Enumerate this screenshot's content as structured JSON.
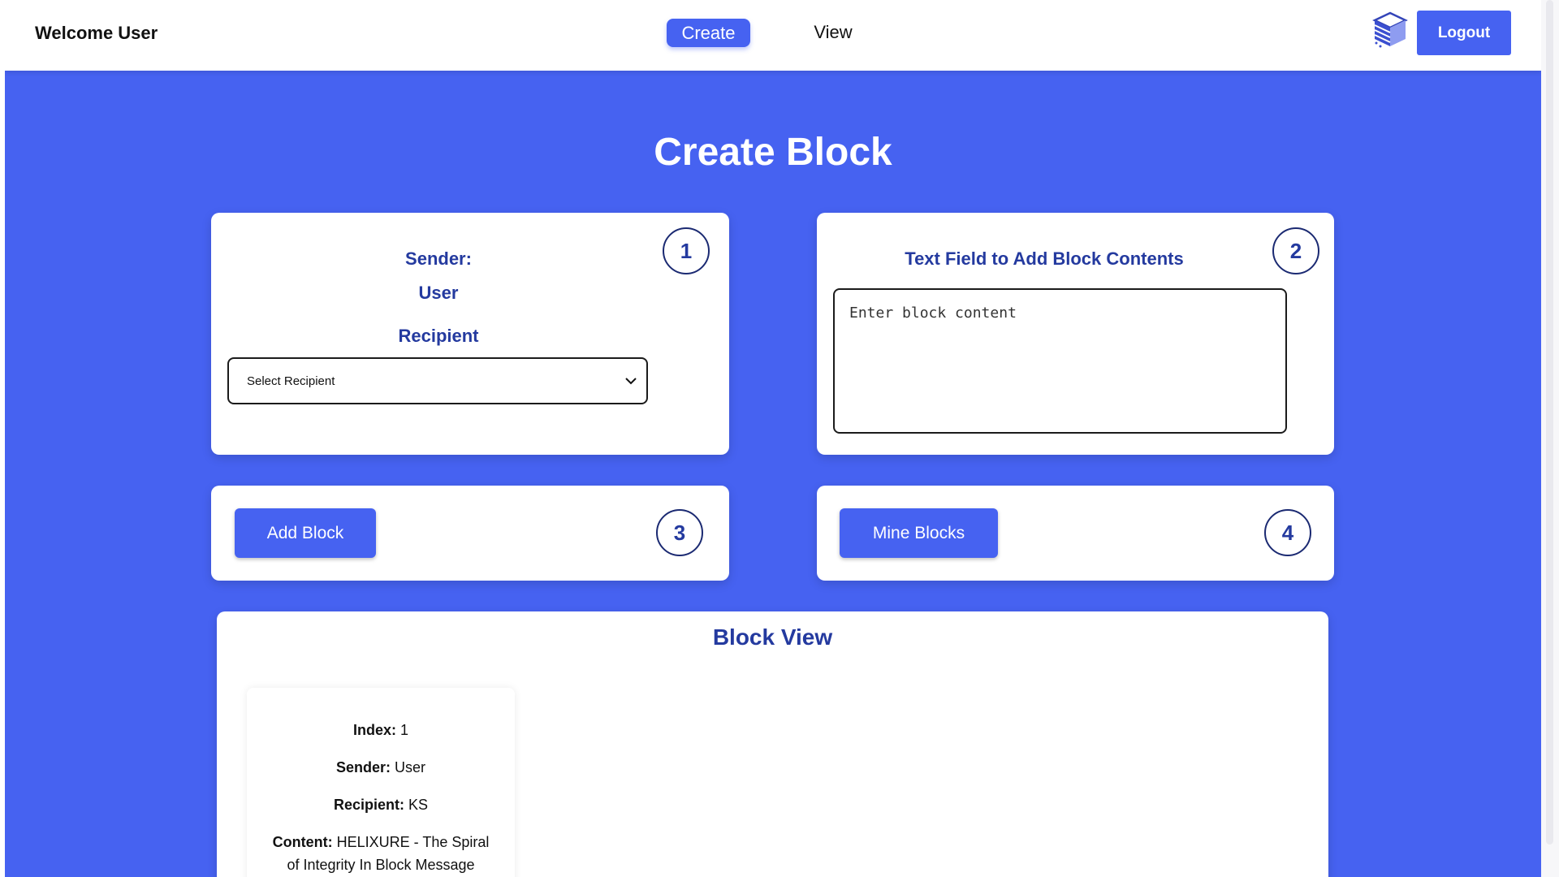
{
  "header": {
    "welcome_text": "Welcome User",
    "nav": {
      "create_label": "Create",
      "view_label": "View"
    },
    "logo_icon": "blockchain-cube-icon",
    "logout_label": "Logout"
  },
  "page": {
    "title": "Create Block"
  },
  "step1": {
    "number": "1",
    "sender_label": "Sender:",
    "sender_value": "User",
    "recipient_label": "Recipient",
    "recipient_select_value": "Select Recipient"
  },
  "step2": {
    "number": "2",
    "label": "Text Field to Add Block Contents",
    "placeholder": "Enter block content"
  },
  "step3": {
    "number": "3",
    "button_label": "Add Block"
  },
  "step4": {
    "number": "4",
    "button_label": "Mine Blocks"
  },
  "block_view": {
    "title": "Block View",
    "blocks": [
      {
        "index_label": "Index:",
        "index_value": "1",
        "sender_label": "Sender:",
        "sender_value": "User",
        "recipient_label": "Recipient:",
        "recipient_value": "KS",
        "content_label": "Content:",
        "content_value": "HELIXURE - The Spiral",
        "content_value_line2": "of Integrity In Block Message"
      }
    ]
  },
  "colors": {
    "accent": "#4662f1",
    "heading": "#243a9f",
    "card": "#ffffff"
  }
}
